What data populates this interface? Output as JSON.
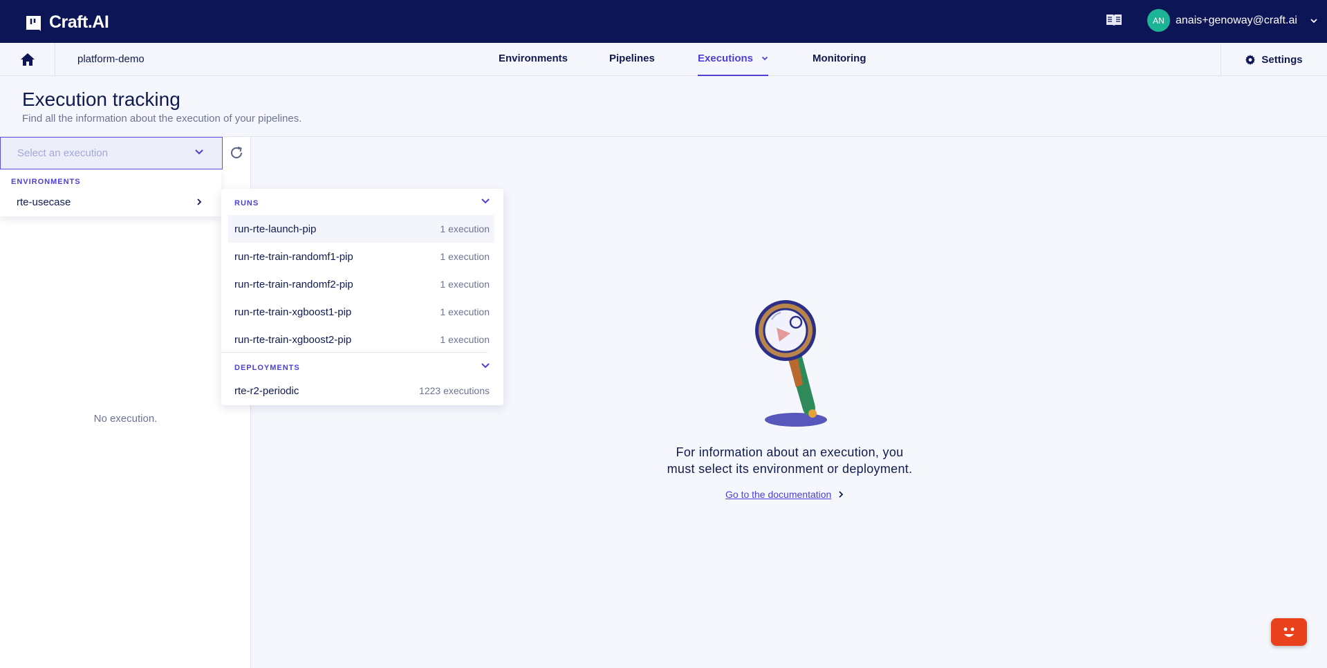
{
  "app": {
    "name": "Craft.AI"
  },
  "topbar": {
    "user_initials": "AN",
    "user_email": "anais+genoway@craft.ai",
    "icons": [
      "doc-book-icon",
      "chevron-down-icon"
    ]
  },
  "nav": {
    "project": "platform-demo",
    "tabs": [
      {
        "label": "Environments"
      },
      {
        "label": "Pipelines"
      },
      {
        "label": "Executions",
        "active": true
      },
      {
        "label": "Monitoring"
      }
    ],
    "settings_label": "Settings"
  },
  "page": {
    "title": "Execution tracking",
    "subtitle": "Find all the information about the execution of your pipelines."
  },
  "left_panel": {
    "select_placeholder": "Select an execution",
    "empty_text": "No execution."
  },
  "env_menu": {
    "section_label": "ENVIRONMENTS",
    "items": [
      {
        "label": "rte-usecase"
      }
    ]
  },
  "runs_menu": {
    "runs_label": "RUNS",
    "runs": [
      {
        "name": "run-rte-launch-pip",
        "count": "1 execution"
      },
      {
        "name": "run-rte-train-randomf1-pip",
        "count": "1 execution"
      },
      {
        "name": "run-rte-train-randomf2-pip",
        "count": "1 execution"
      },
      {
        "name": "run-rte-train-xgboost1-pip",
        "count": "1 execution"
      },
      {
        "name": "run-rte-train-xgboost2-pip",
        "count": "1 execution"
      }
    ],
    "deployments_label": "DEPLOYMENTS",
    "deployments": [
      {
        "name": "rte-r2-periodic",
        "count": "1223 executions"
      }
    ]
  },
  "empty_state": {
    "line1": "For information about an execution, you",
    "line2": "must select its environment or deployment.",
    "link": "Go to the documentation"
  },
  "colors": {
    "topbar": "#0c1556",
    "accent": "#4b3fd6",
    "avatar": "#1db397",
    "chat": "#e8411b"
  }
}
